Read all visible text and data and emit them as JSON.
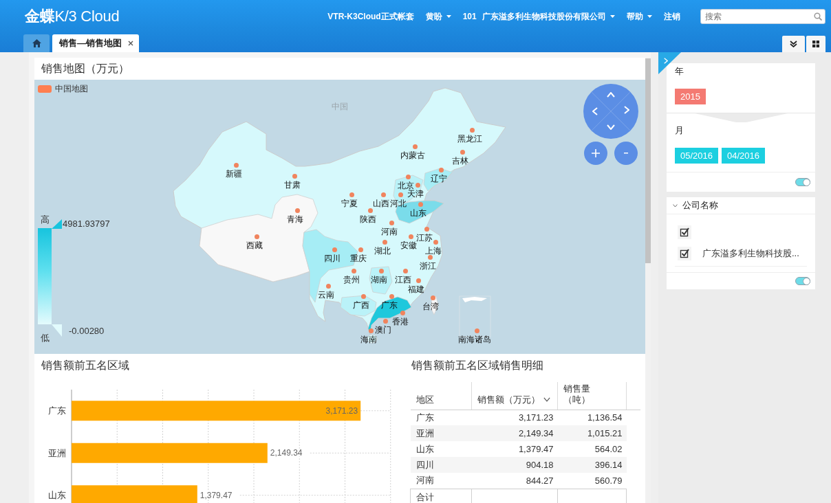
{
  "header": {
    "logo": "**金蝶**K/3 Cloud",
    "menu": [
      {
        "label": "VTR-K3Cloud正式帐套",
        "has_menu": false
      },
      {
        "label": "黄盼",
        "has_menu": true
      },
      {
        "label": "101 广东溢多利生物科技股份有限公司",
        "has_menu": true
      },
      {
        "label": "帮助",
        "has_menu": true
      },
      {
        "label": "注销",
        "has_menu": false
      }
    ],
    "search": {
      "placeholder": "搜索"
    }
  },
  "tabs": [
    {
      "kind": "home",
      "selected": false
    },
    {
      "kind": "page",
      "label": "销售—销售地图",
      "selected": true,
      "closable": true
    }
  ],
  "map_panel": {
    "title": "销售地图（万元）",
    "legend": "中国地图",
    "map_name": "中国",
    "visual_map": {
      "high_label": "高",
      "max": "4981.93797",
      "min": "-0.00280",
      "low_label": "低"
    },
    "region_labels": [
      "黑龙江",
      "内蒙古",
      "吉林",
      "新疆",
      "辽宁",
      "甘肃",
      "北京",
      "天津",
      "宁夏",
      "山西",
      "河北",
      "山东",
      "青海",
      "陕西",
      "河南",
      "江苏",
      "西藏",
      "安徽",
      "湖北",
      "上海",
      "四川",
      "重庆",
      "浙江",
      "贵州",
      "湖南",
      "江西",
      "福建",
      "云南",
      "广西",
      "广东",
      "台湾",
      "香港",
      "澳门",
      "海南",
      "南海诸岛"
    ]
  },
  "top_regions": {
    "title": "销售额前五名区域",
    "chart_data": {
      "type": "bar",
      "orientation": "horizontal",
      "categories": [
        "广东",
        "亚洲",
        "山东"
      ],
      "values": [
        3171.23,
        2149.34,
        1379.47
      ],
      "xlim": [
        0,
        3500
      ],
      "value_labels": [
        "3,171.23",
        "2,149.34",
        "1,379.47"
      ]
    }
  },
  "detail_table": {
    "title": "销售额前五名区域销售明细",
    "columns": [
      {
        "label": "地区",
        "sorted": false
      },
      {
        "label": "销售额（万元）",
        "sorted": true
      },
      {
        "label": "销售量（吨）",
        "sorted": false
      }
    ],
    "rows": [
      [
        "广东",
        "3,171.23",
        "1,136.54"
      ],
      [
        "亚洲",
        "2,149.34",
        "1,015.21"
      ],
      [
        "山东",
        "1,379.47",
        "564.02"
      ],
      [
        "四川",
        "904.18",
        "396.14"
      ],
      [
        "河南",
        "844.27",
        "560.79"
      ]
    ],
    "footer": "合计"
  },
  "filters": {
    "period_card": {
      "groups": [
        {
          "title": "年",
          "color": "#f47a72",
          "tags": [
            "2015"
          ]
        },
        {
          "title": "月",
          "color": "#1ccfe0",
          "tags": [
            "05/2016",
            "04/2016"
          ]
        }
      ],
      "toggle_on": true
    },
    "company_card": {
      "title": "公司名称",
      "expanded": true,
      "items": [
        {
          "checked": true
        },
        {
          "label": "广东溢多利生物科技股...",
          "checked": true
        }
      ],
      "toggle_on": true
    }
  }
}
